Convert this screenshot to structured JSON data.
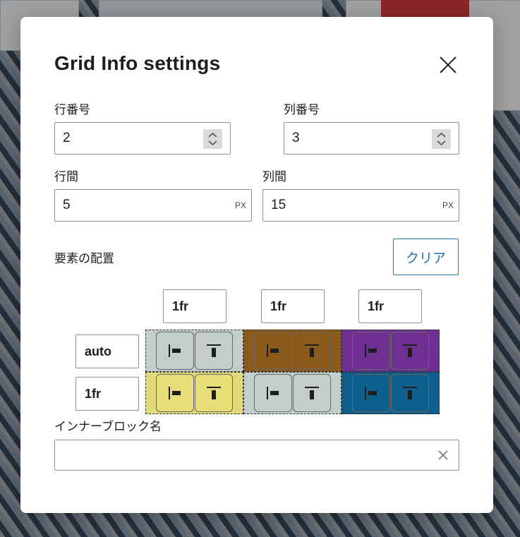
{
  "modal": {
    "title": "Grid Info settings",
    "close_icon": "close-icon"
  },
  "fields": {
    "row_count": {
      "label": "行番号",
      "value": "2"
    },
    "col_count": {
      "label": "列番号",
      "value": "3"
    },
    "row_gap": {
      "label": "行間",
      "value": "5",
      "unit": "PX"
    },
    "col_gap": {
      "label": "列間",
      "value": "15",
      "unit": "PX"
    }
  },
  "placement": {
    "label": "要素の配置",
    "clear_label": "クリア"
  },
  "grid": {
    "columns": [
      "1fr",
      "1fr",
      "1fr"
    ],
    "rows": [
      "auto",
      "1fr"
    ],
    "cells": [
      {
        "color": "#c3cdcb",
        "button_color": "#c3cdcb"
      },
      {
        "color": "#8b5a1a",
        "button_color": "#8b5a1a"
      },
      {
        "color": "#6f2f92",
        "button_color": "#6f2f92"
      },
      {
        "color": "#e2d97a",
        "button_color": "#e8de77"
      },
      {
        "color": "#c3cdcb",
        "button_color": "#c3cdcb"
      },
      {
        "color": "#0f5f8c",
        "button_color": "#0f5f8c"
      }
    ],
    "icons": [
      "justify-left-icon",
      "align-top-icon"
    ]
  },
  "inner_block": {
    "label": "インナーブロック名",
    "value": "",
    "clear_icon": "clear-icon"
  }
}
